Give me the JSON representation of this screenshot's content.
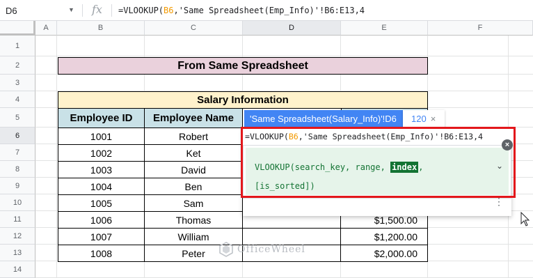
{
  "formula_bar": {
    "cell_ref": "D6",
    "fx": "fx",
    "formula_prefix": "=VLOOKUP(",
    "formula_ref": "B6",
    "formula_rest": ",'Same Spreadsheet(Emp_Info)'!B6:E13,4"
  },
  "columns": [
    "A",
    "B",
    "C",
    "D",
    "E",
    "F"
  ],
  "rows": [
    "1",
    "2",
    "3",
    "4",
    "5",
    "6",
    "7",
    "8",
    "9",
    "10",
    "11",
    "12",
    "13",
    "14"
  ],
  "title": "From Same Spreadsheet",
  "salary_header": "Salary Information",
  "table": {
    "headers": [
      "Employee ID",
      "Employee Name"
    ],
    "ids": [
      "1001",
      "1002",
      "1003",
      "1004",
      "1005",
      "1006",
      "1007",
      "1008"
    ],
    "names": [
      "Robert",
      "Ket",
      "David",
      "Ben",
      "Sam",
      "Thomas",
      "William",
      "Peter"
    ],
    "salaries": [
      "$1,500.00",
      "$1,200.00",
      "$2,000.00"
    ]
  },
  "range_chip": {
    "label": "'Same Spreadsheet(Salary_Info)'!D6",
    "value": "120",
    "close": "×"
  },
  "edit_cell": {
    "prefix": "=VLOOKUP(",
    "ref": "B6",
    "rest": ",'Same Spreadsheet(Emp_Info)'!B6:E13,4"
  },
  "formula_help": {
    "line1_before": "VLOOKUP(search_key, range, ",
    "highlight": "index",
    "line1_after": ",",
    "line2": "[is_sorted])",
    "chevron": "⌄",
    "more": "⋮",
    "close": "×"
  },
  "watermark": "OfficeWheel",
  "colors": {
    "title_bg": "#ead1dc",
    "salary_header_bg": "#fff2cc",
    "table_header_bg": "#c9e1e7",
    "chip_blue": "#4285f4",
    "help_green": "#137333",
    "annotation_red": "#e3171b",
    "ref_orange": "#f29900"
  }
}
